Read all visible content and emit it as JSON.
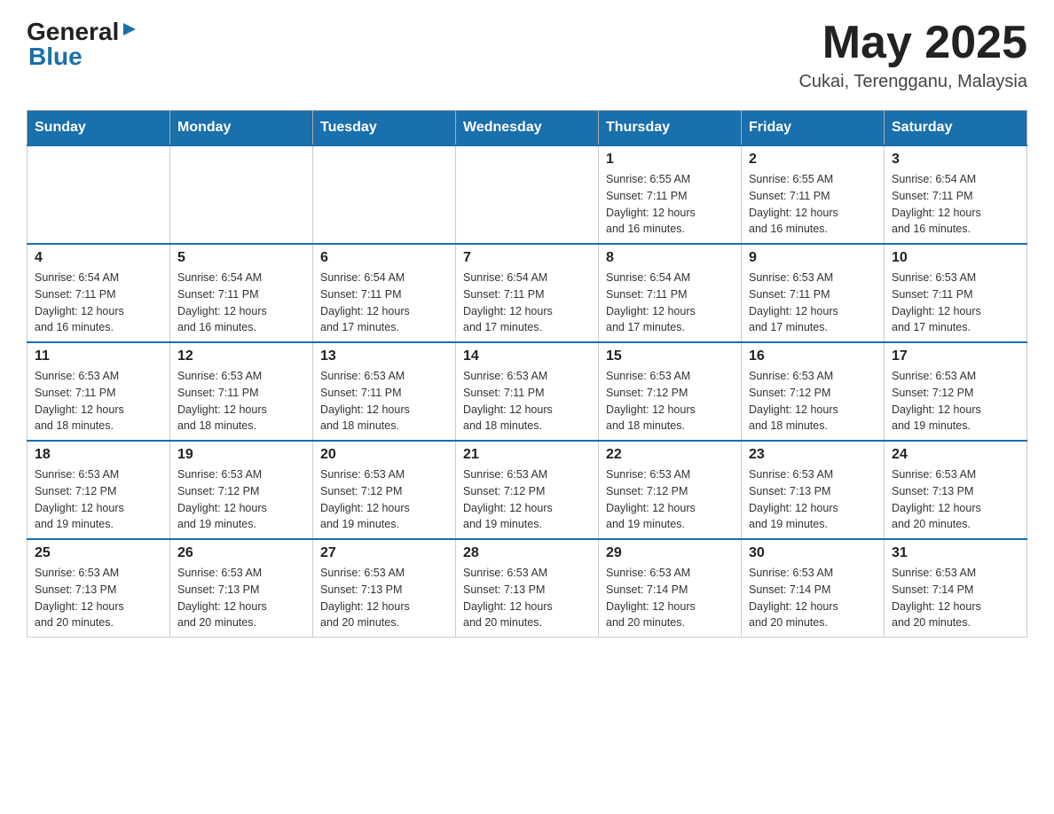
{
  "header": {
    "logo": {
      "general": "General",
      "arrow_symbol": "▶",
      "blue": "Blue"
    },
    "title": "May 2025",
    "location": "Cukai, Terengganu, Malaysia"
  },
  "calendar": {
    "days_of_week": [
      "Sunday",
      "Monday",
      "Tuesday",
      "Wednesday",
      "Thursday",
      "Friday",
      "Saturday"
    ],
    "weeks": [
      {
        "days": [
          {
            "number": "",
            "info": ""
          },
          {
            "number": "",
            "info": ""
          },
          {
            "number": "",
            "info": ""
          },
          {
            "number": "",
            "info": ""
          },
          {
            "number": "1",
            "info": "Sunrise: 6:55 AM\nSunset: 7:11 PM\nDaylight: 12 hours\nand 16 minutes."
          },
          {
            "number": "2",
            "info": "Sunrise: 6:55 AM\nSunset: 7:11 PM\nDaylight: 12 hours\nand 16 minutes."
          },
          {
            "number": "3",
            "info": "Sunrise: 6:54 AM\nSunset: 7:11 PM\nDaylight: 12 hours\nand 16 minutes."
          }
        ]
      },
      {
        "days": [
          {
            "number": "4",
            "info": "Sunrise: 6:54 AM\nSunset: 7:11 PM\nDaylight: 12 hours\nand 16 minutes."
          },
          {
            "number": "5",
            "info": "Sunrise: 6:54 AM\nSunset: 7:11 PM\nDaylight: 12 hours\nand 16 minutes."
          },
          {
            "number": "6",
            "info": "Sunrise: 6:54 AM\nSunset: 7:11 PM\nDaylight: 12 hours\nand 17 minutes."
          },
          {
            "number": "7",
            "info": "Sunrise: 6:54 AM\nSunset: 7:11 PM\nDaylight: 12 hours\nand 17 minutes."
          },
          {
            "number": "8",
            "info": "Sunrise: 6:54 AM\nSunset: 7:11 PM\nDaylight: 12 hours\nand 17 minutes."
          },
          {
            "number": "9",
            "info": "Sunrise: 6:53 AM\nSunset: 7:11 PM\nDaylight: 12 hours\nand 17 minutes."
          },
          {
            "number": "10",
            "info": "Sunrise: 6:53 AM\nSunset: 7:11 PM\nDaylight: 12 hours\nand 17 minutes."
          }
        ]
      },
      {
        "days": [
          {
            "number": "11",
            "info": "Sunrise: 6:53 AM\nSunset: 7:11 PM\nDaylight: 12 hours\nand 18 minutes."
          },
          {
            "number": "12",
            "info": "Sunrise: 6:53 AM\nSunset: 7:11 PM\nDaylight: 12 hours\nand 18 minutes."
          },
          {
            "number": "13",
            "info": "Sunrise: 6:53 AM\nSunset: 7:11 PM\nDaylight: 12 hours\nand 18 minutes."
          },
          {
            "number": "14",
            "info": "Sunrise: 6:53 AM\nSunset: 7:11 PM\nDaylight: 12 hours\nand 18 minutes."
          },
          {
            "number": "15",
            "info": "Sunrise: 6:53 AM\nSunset: 7:12 PM\nDaylight: 12 hours\nand 18 minutes."
          },
          {
            "number": "16",
            "info": "Sunrise: 6:53 AM\nSunset: 7:12 PM\nDaylight: 12 hours\nand 18 minutes."
          },
          {
            "number": "17",
            "info": "Sunrise: 6:53 AM\nSunset: 7:12 PM\nDaylight: 12 hours\nand 19 minutes."
          }
        ]
      },
      {
        "days": [
          {
            "number": "18",
            "info": "Sunrise: 6:53 AM\nSunset: 7:12 PM\nDaylight: 12 hours\nand 19 minutes."
          },
          {
            "number": "19",
            "info": "Sunrise: 6:53 AM\nSunset: 7:12 PM\nDaylight: 12 hours\nand 19 minutes."
          },
          {
            "number": "20",
            "info": "Sunrise: 6:53 AM\nSunset: 7:12 PM\nDaylight: 12 hours\nand 19 minutes."
          },
          {
            "number": "21",
            "info": "Sunrise: 6:53 AM\nSunset: 7:12 PM\nDaylight: 12 hours\nand 19 minutes."
          },
          {
            "number": "22",
            "info": "Sunrise: 6:53 AM\nSunset: 7:12 PM\nDaylight: 12 hours\nand 19 minutes."
          },
          {
            "number": "23",
            "info": "Sunrise: 6:53 AM\nSunset: 7:13 PM\nDaylight: 12 hours\nand 19 minutes."
          },
          {
            "number": "24",
            "info": "Sunrise: 6:53 AM\nSunset: 7:13 PM\nDaylight: 12 hours\nand 20 minutes."
          }
        ]
      },
      {
        "days": [
          {
            "number": "25",
            "info": "Sunrise: 6:53 AM\nSunset: 7:13 PM\nDaylight: 12 hours\nand 20 minutes."
          },
          {
            "number": "26",
            "info": "Sunrise: 6:53 AM\nSunset: 7:13 PM\nDaylight: 12 hours\nand 20 minutes."
          },
          {
            "number": "27",
            "info": "Sunrise: 6:53 AM\nSunset: 7:13 PM\nDaylight: 12 hours\nand 20 minutes."
          },
          {
            "number": "28",
            "info": "Sunrise: 6:53 AM\nSunset: 7:13 PM\nDaylight: 12 hours\nand 20 minutes."
          },
          {
            "number": "29",
            "info": "Sunrise: 6:53 AM\nSunset: 7:14 PM\nDaylight: 12 hours\nand 20 minutes."
          },
          {
            "number": "30",
            "info": "Sunrise: 6:53 AM\nSunset: 7:14 PM\nDaylight: 12 hours\nand 20 minutes."
          },
          {
            "number": "31",
            "info": "Sunrise: 6:53 AM\nSunset: 7:14 PM\nDaylight: 12 hours\nand 20 minutes."
          }
        ]
      }
    ]
  }
}
